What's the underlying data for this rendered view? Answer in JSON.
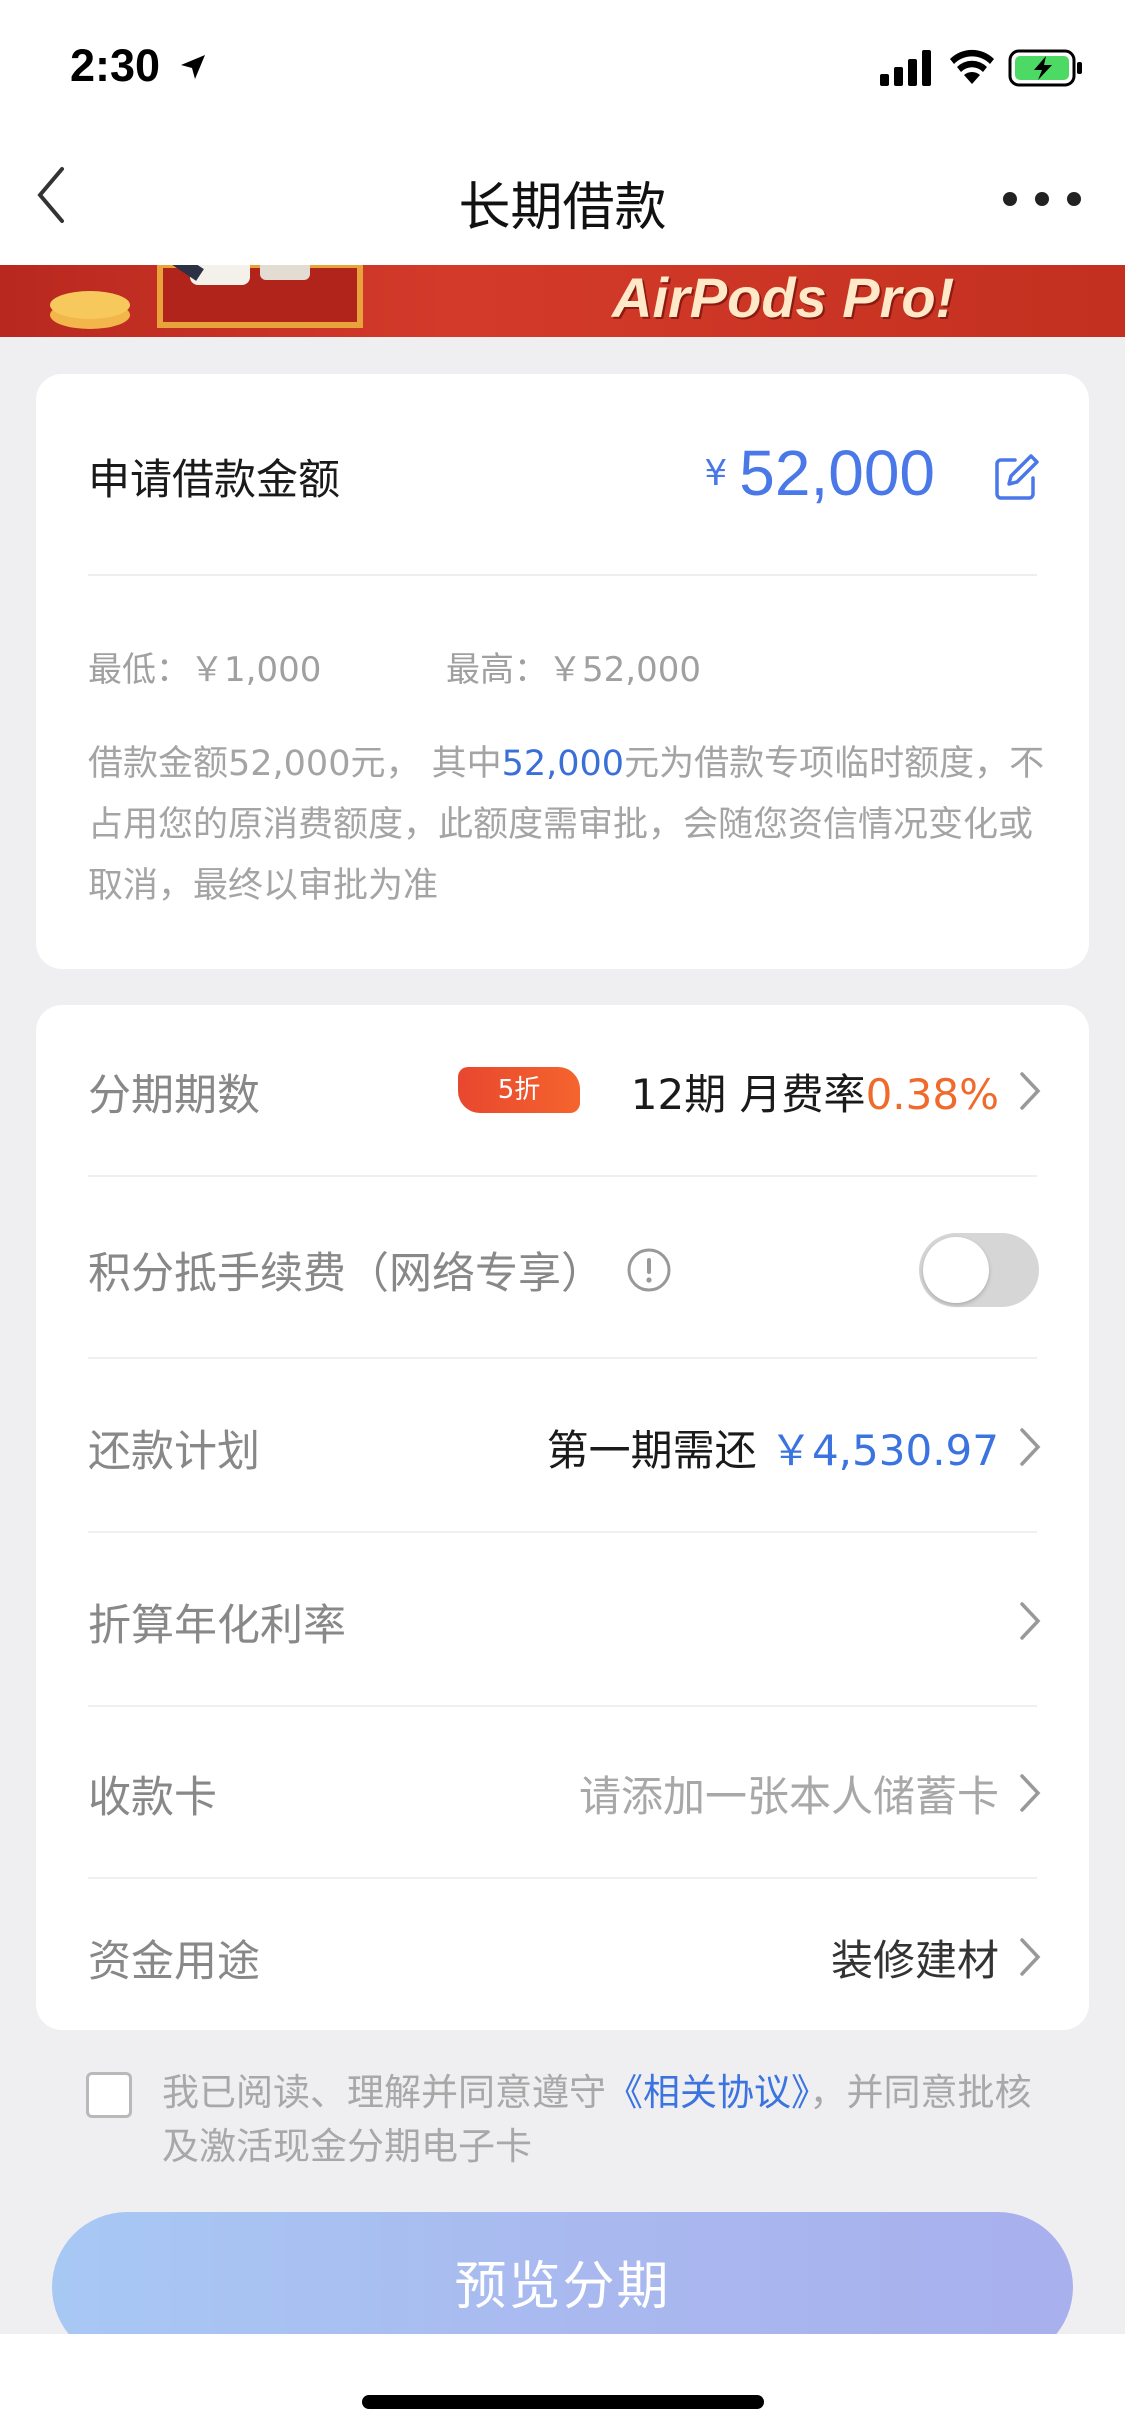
{
  "status_bar": {
    "time": "2:30",
    "icons": [
      "location-arrow-icon",
      "cellular-signal-icon",
      "wifi-icon",
      "battery-charging-icon"
    ],
    "battery_color": "#4cd964"
  },
  "nav": {
    "title": "长期借款",
    "back_icon": "chevron-left-icon",
    "more_icon": "more-dots-icon"
  },
  "banner": {
    "text": "AirPods Pro!"
  },
  "amount_card": {
    "label": "申请借款金额",
    "currency": "¥",
    "amount": "52,000",
    "min_text": "最低：￥1,000",
    "max_text": "最高：￥52,000",
    "desc_part1": "借款金额52,000元， 其中",
    "desc_highlight": "52,000",
    "desc_part2": "元为借款专项临时额度，不占用您的原消费额度，此额度需审批，会随您资信情况变化或取消，最终以审批为准",
    "accent_color": "#4a78e8"
  },
  "options": {
    "periods": {
      "label": "分期期数",
      "badge": "5折",
      "value_prefix": "12期  月费率",
      "rate": "0.38%"
    },
    "points": {
      "label": "积分抵手续费（网络专享）",
      "toggle_on": false
    },
    "repay_plan": {
      "label": "还款计划",
      "value_prefix": "第一期需还 ",
      "amount": "￥4,530.97"
    },
    "annual_rate": {
      "label": "折算年化利率"
    },
    "receiving_card": {
      "label": "收款卡",
      "value": "请添加一张本人储蓄卡"
    },
    "purpose": {
      "label": "资金用途",
      "value": "装修建材"
    }
  },
  "agreement": {
    "text_before": "我已阅读、理解并同意遵守",
    "link": "《相关协议》",
    "text_after": "，并同意批核及激活现金分期电子卡",
    "checked": false
  },
  "preview_button": {
    "label": "预览分期"
  }
}
